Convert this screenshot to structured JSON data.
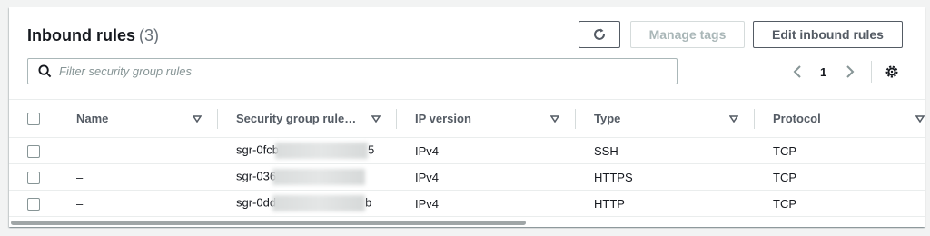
{
  "header": {
    "title": "Inbound rules",
    "count": "(3)",
    "manage_tags_label": "Manage tags",
    "edit_label": "Edit inbound rules"
  },
  "search": {
    "placeholder": "Filter security group rules"
  },
  "pagination": {
    "page": "1"
  },
  "columns": [
    "Name",
    "Security group rule…",
    "IP version",
    "Type",
    "Protocol"
  ],
  "rows": [
    {
      "name": "–",
      "rule_id_prefix": "sgr-0fcb",
      "rule_id_suffix": "5",
      "ip_version": "IPv4",
      "type": "SSH",
      "protocol": "TCP"
    },
    {
      "name": "–",
      "rule_id_prefix": "sgr-036",
      "rule_id_suffix": "",
      "ip_version": "IPv4",
      "type": "HTTPS",
      "protocol": "TCP"
    },
    {
      "name": "–",
      "rule_id_prefix": "sgr-0dd",
      "rule_id_suffix": "b",
      "ip_version": "IPv4",
      "type": "HTTP",
      "protocol": "TCP"
    }
  ],
  "icons": {
    "refresh": "refresh-icon",
    "search": "search-icon",
    "prev": "chevron-left-icon",
    "next": "chevron-right-icon",
    "settings": "gear-icon",
    "sort": "caret-down-icon"
  },
  "colors": {
    "border": "#545b64",
    "disabled": "#aab7b8",
    "text": "#16191f"
  }
}
